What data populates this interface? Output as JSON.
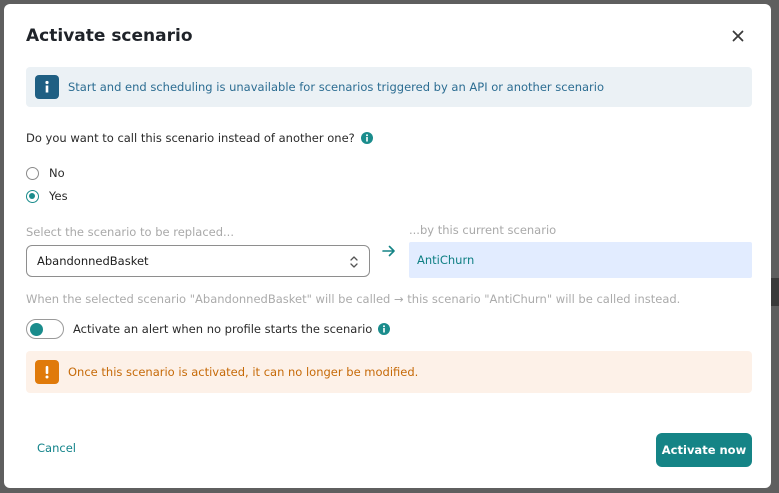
{
  "dialog": {
    "title": "Activate scenario",
    "close_icon": "close-icon"
  },
  "info_banner": {
    "icon": "info-icon",
    "text": "Start and end scheduling is unavailable for scenarios triggered by an API or another scenario"
  },
  "replace_question": {
    "label": "Do you want to call this scenario instead of another one?",
    "info_icon": "info-icon",
    "options": [
      {
        "label": "No",
        "checked": false
      },
      {
        "label": "Yes",
        "checked": true
      }
    ]
  },
  "replacement": {
    "select_label": "Select the scenario to be replaced...",
    "selected_value": "AbandonnedBasket",
    "arrow_icon": "arrow-right-icon",
    "current_label": "...by this current scenario",
    "current_value": "AntiChurn",
    "explanation": "When the selected scenario \"AbandonnedBasket\" will be called → this scenario \"AntiChurn\" will be called instead."
  },
  "alert_toggle": {
    "label": "Activate an alert when no profile starts the scenario",
    "on": false
  },
  "warning": {
    "icon": "warning-icon",
    "text": "Once this scenario is activated, it can no longer be modified."
  },
  "footer": {
    "cancel_label": "Cancel",
    "activate_label": "Activate now"
  },
  "colors": {
    "accent": "#158486",
    "info_bg": "#ebf1f5",
    "warning_bg": "#fdf1e8",
    "warning_accent": "#e07a0a"
  }
}
